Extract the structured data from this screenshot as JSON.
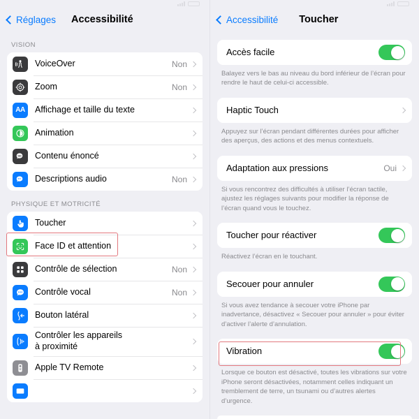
{
  "left": {
    "statusbar": {
      "time": "",
      "carrier": ""
    },
    "nav": {
      "back_label": "Réglages",
      "title": "Accessibilité"
    },
    "sections": [
      {
        "header": "VISION",
        "items": [
          {
            "label": "VoiceOver",
            "value": "Non",
            "icon": "voiceover-icon",
            "icon_color": "#3A3A3C"
          },
          {
            "label": "Zoom",
            "value": "Non",
            "icon": "zoom-icon",
            "icon_color": "#3A3A3C"
          },
          {
            "label": "Affichage et taille du texte",
            "value": "",
            "icon": "text-size-icon",
            "icon_color": "#0A7CFF"
          },
          {
            "label": "Animation",
            "value": "",
            "icon": "motion-icon",
            "icon_color": "#34C759"
          },
          {
            "label": "Contenu énoncé",
            "value": "",
            "icon": "spoken-content-icon",
            "icon_color": "#3A3A3C"
          },
          {
            "label": "Descriptions audio",
            "value": "Non",
            "icon": "audio-descriptions-icon",
            "icon_color": "#0A7CFF"
          }
        ]
      },
      {
        "header": "PHYSIQUE ET MOTRICITÉ",
        "items": [
          {
            "label": "Toucher",
            "value": "",
            "icon": "touch-icon",
            "icon_color": "#0A7CFF"
          },
          {
            "label": "Face ID et attention",
            "value": "",
            "icon": "face-id-icon",
            "icon_color": "#34C759"
          },
          {
            "label": "Contrôle de sélection",
            "value": "Non",
            "icon": "switch-control-icon",
            "icon_color": "#3A3A3C"
          },
          {
            "label": "Contrôle vocal",
            "value": "Non",
            "icon": "voice-control-icon",
            "icon_color": "#0A7CFF"
          },
          {
            "label": "Bouton latéral",
            "value": "",
            "icon": "side-button-icon",
            "icon_color": "#0A7CFF"
          },
          {
            "label": "Contrôler les appareils\nà proximité",
            "value": "",
            "icon": "nearby-devices-icon",
            "icon_color": "#0A7CFF"
          },
          {
            "label": "Apple TV Remote",
            "value": "",
            "icon": "apple-tv-remote-icon",
            "icon_color": "#8E8E93"
          },
          {
            "label": "",
            "value": "",
            "icon": "keyboard-icon",
            "icon_color": "#0A7CFF"
          }
        ]
      }
    ]
  },
  "right": {
    "nav": {
      "back_label": "Accessibilité",
      "title": "Toucher"
    },
    "blocks": [
      {
        "rows": [
          {
            "label": "Accès facile",
            "type": "toggle",
            "on": true
          }
        ],
        "footnote": "Balayez vers le bas au niveau du bord inférieur de l’écran pour rendre le haut de celui-ci accessible."
      },
      {
        "rows": [
          {
            "label": "Haptic Touch",
            "type": "link",
            "value": ""
          }
        ],
        "footnote": "Appuyez sur l’écran pendant différentes durées pour afficher des aperçus, des actions et des menus contextuels."
      },
      {
        "rows": [
          {
            "label": "Adaptation aux pressions",
            "type": "link",
            "value": "Oui"
          }
        ],
        "footnote": "Si vous rencontrez des difficultés à utiliser l’écran tactile, ajustez les réglages suivants pour modifier la réponse de l’écran quand vous le touchez."
      },
      {
        "rows": [
          {
            "label": "Toucher pour réactiver",
            "type": "toggle",
            "on": true
          }
        ],
        "footnote": "Réactivez l’écran en le touchant."
      },
      {
        "rows": [
          {
            "label": "Secouer pour annuler",
            "type": "toggle",
            "on": true
          }
        ],
        "footnote": "Si vous avez tendance à secouer votre iPhone par inadvertance, désactivez « Secouer pour annuler » pour éviter d’activer l’alerte d’annulation."
      },
      {
        "rows": [
          {
            "label": "Vibration",
            "type": "toggle",
            "on": true
          }
        ],
        "footnote": "Lorsque ce bouton est désactivé, toutes les vibrations sur votre iPhone seront désactivées, notamment celles indiquant un tremblement de terre, un tsunami ou d’autres alertes d’urgence."
      }
    ]
  },
  "annotations": {
    "color": "#E2787E",
    "highlighted": [
      "Toucher",
      "Vibration"
    ]
  }
}
